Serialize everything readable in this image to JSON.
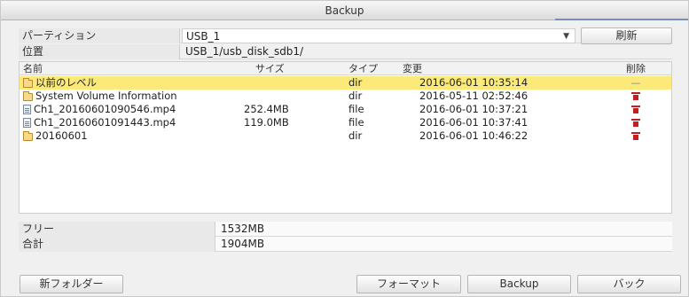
{
  "window": {
    "title": "Backup"
  },
  "form": {
    "partition_label": "パーティション",
    "partition_value": "USB_1",
    "refresh_label": "刷新",
    "location_label": "位置",
    "location_value": "USB_1/usb_disk_sdb1/"
  },
  "table": {
    "headers": {
      "name": "名前",
      "size": "サイズ",
      "type": "タイプ",
      "modified": "変更",
      "delete": "削除"
    },
    "rows": [
      {
        "name": "以前のレベル",
        "size": "",
        "type": "dir",
        "modified": "2016-06-01 10:35:14",
        "icon": "folder-up-icon",
        "delete_icon": "dash-icon",
        "selected": true
      },
      {
        "name": "System Volume Information",
        "size": "",
        "type": "dir",
        "modified": "2016-05-11 02:52:46",
        "icon": "folder-icon",
        "delete_icon": "trash-icon",
        "selected": false
      },
      {
        "name": "Ch1_20160601090546.mp4",
        "size": "252.4MB",
        "type": "file",
        "modified": "2016-06-01 10:37:21",
        "icon": "file-icon",
        "delete_icon": "trash-icon",
        "selected": false
      },
      {
        "name": "Ch1_20160601091443.mp4",
        "size": "119.0MB",
        "type": "file",
        "modified": "2016-06-01 10:37:41",
        "icon": "file-icon",
        "delete_icon": "trash-icon",
        "selected": false
      },
      {
        "name": "20160601",
        "size": "",
        "type": "dir",
        "modified": "2016-06-01 10:46:22",
        "icon": "folder-icon",
        "delete_icon": "trash-icon",
        "selected": false
      }
    ]
  },
  "info": {
    "free_label": "フリー",
    "free_value": "1532MB",
    "total_label": "合計",
    "total_value": "1904MB"
  },
  "buttons": {
    "new_folder": "新フォルダー",
    "format": "フォーマット",
    "backup": "Backup",
    "back": "バック"
  },
  "colors": {
    "selected_row": "#fbea7a",
    "delete_icon": "#c02020",
    "folder": "#f7d98a"
  }
}
